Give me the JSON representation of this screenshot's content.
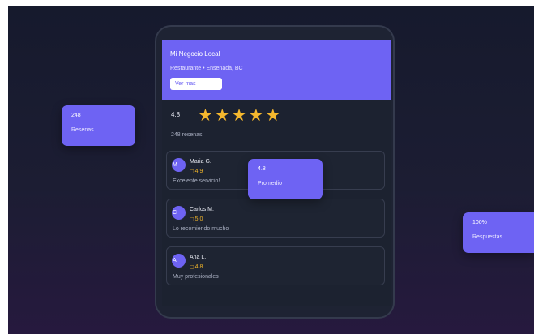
{
  "business": {
    "name": "Mi Negocio Local",
    "subtitle": "Restaurante • Ensenada, BC",
    "button_label": "Ver mas"
  },
  "rating": {
    "value": "4.8",
    "stars": 5,
    "count_text": "248 resenas"
  },
  "reviews": [
    {
      "initial": "M",
      "name": "Maria G.",
      "icon": "square-icon",
      "score": "4.9",
      "text": "Excelente servicio!"
    },
    {
      "initial": "C",
      "name": "Carlos M.",
      "icon": "square-icon",
      "score": "5.0",
      "text": "Lo recomiendo mucho"
    },
    {
      "initial": "A",
      "name": "Ana L.",
      "icon": "square-icon",
      "score": "4.8",
      "text": "Muy profesionales"
    }
  ],
  "stats": {
    "reviews": {
      "value": "248",
      "label": "Resenas"
    },
    "average": {
      "value": "4.8",
      "label": "Promedio"
    },
    "responses": {
      "value": "100%",
      "label": "Respuestas"
    }
  },
  "colors": {
    "accent": "#6e63f3",
    "star": "#f5b82e",
    "panel": "#1c2230"
  }
}
